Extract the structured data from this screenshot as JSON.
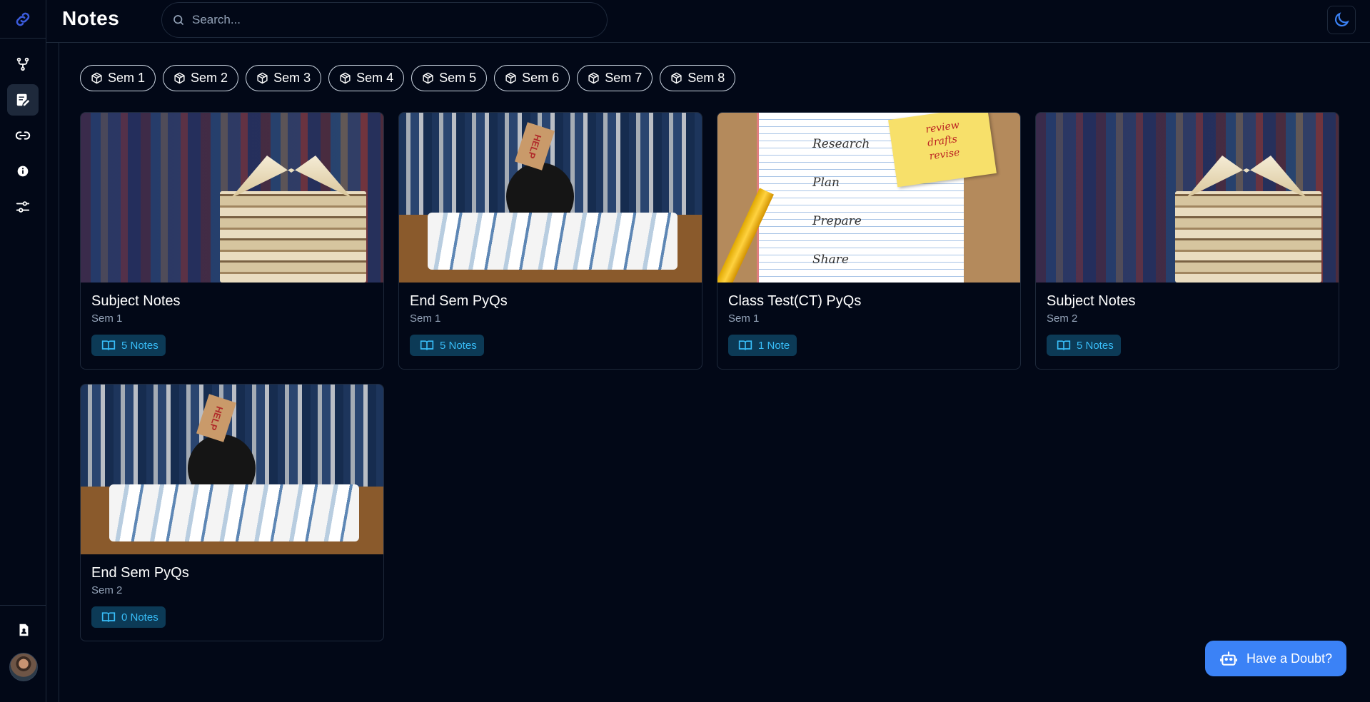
{
  "header": {
    "title": "Notes",
    "search_placeholder": "Search..."
  },
  "sidebar": {
    "items": [
      {
        "icon": "git-fork-icon"
      },
      {
        "icon": "notes-icon",
        "active": true
      },
      {
        "icon": "link-icon"
      },
      {
        "icon": "info-icon"
      },
      {
        "icon": "sliders-icon"
      }
    ],
    "bottom": [
      {
        "icon": "contact-file-icon"
      },
      {
        "icon": "avatar"
      }
    ]
  },
  "semesters": [
    "Sem 1",
    "Sem 2",
    "Sem 3",
    "Sem 4",
    "Sem 5",
    "Sem 6",
    "Sem 7",
    "Sem 8"
  ],
  "cards": [
    {
      "title": "Subject Notes",
      "sem": "Sem 1",
      "count": "5 Notes",
      "image": "books-stack"
    },
    {
      "title": "End Sem PyQs",
      "sem": "Sem 1",
      "count": "5 Notes",
      "image": "student-help"
    },
    {
      "title": "Class Test(CT) PyQs",
      "sem": "Sem 1",
      "count": "1 Note",
      "image": "study-plan"
    },
    {
      "title": "Subject Notes",
      "sem": "Sem 2",
      "count": "5 Notes",
      "image": "books-stack"
    },
    {
      "title": "End Sem PyQs",
      "sem": "Sem 2",
      "count": "0 Notes",
      "image": "student-help"
    }
  ],
  "image_text": {
    "help_sign": "HELP",
    "plan_rows": [
      "Research",
      "Plan",
      "Prepare",
      "Share"
    ],
    "plan_note": [
      "review",
      "drafts",
      "revise"
    ]
  },
  "doubt_button": {
    "label": "Have a Doubt?"
  },
  "colors": {
    "background": "#020817",
    "border": "#1e293b",
    "badge_bg": "#0c3a56",
    "badge_text": "#38bdf8",
    "accent": "#3b82f6"
  }
}
